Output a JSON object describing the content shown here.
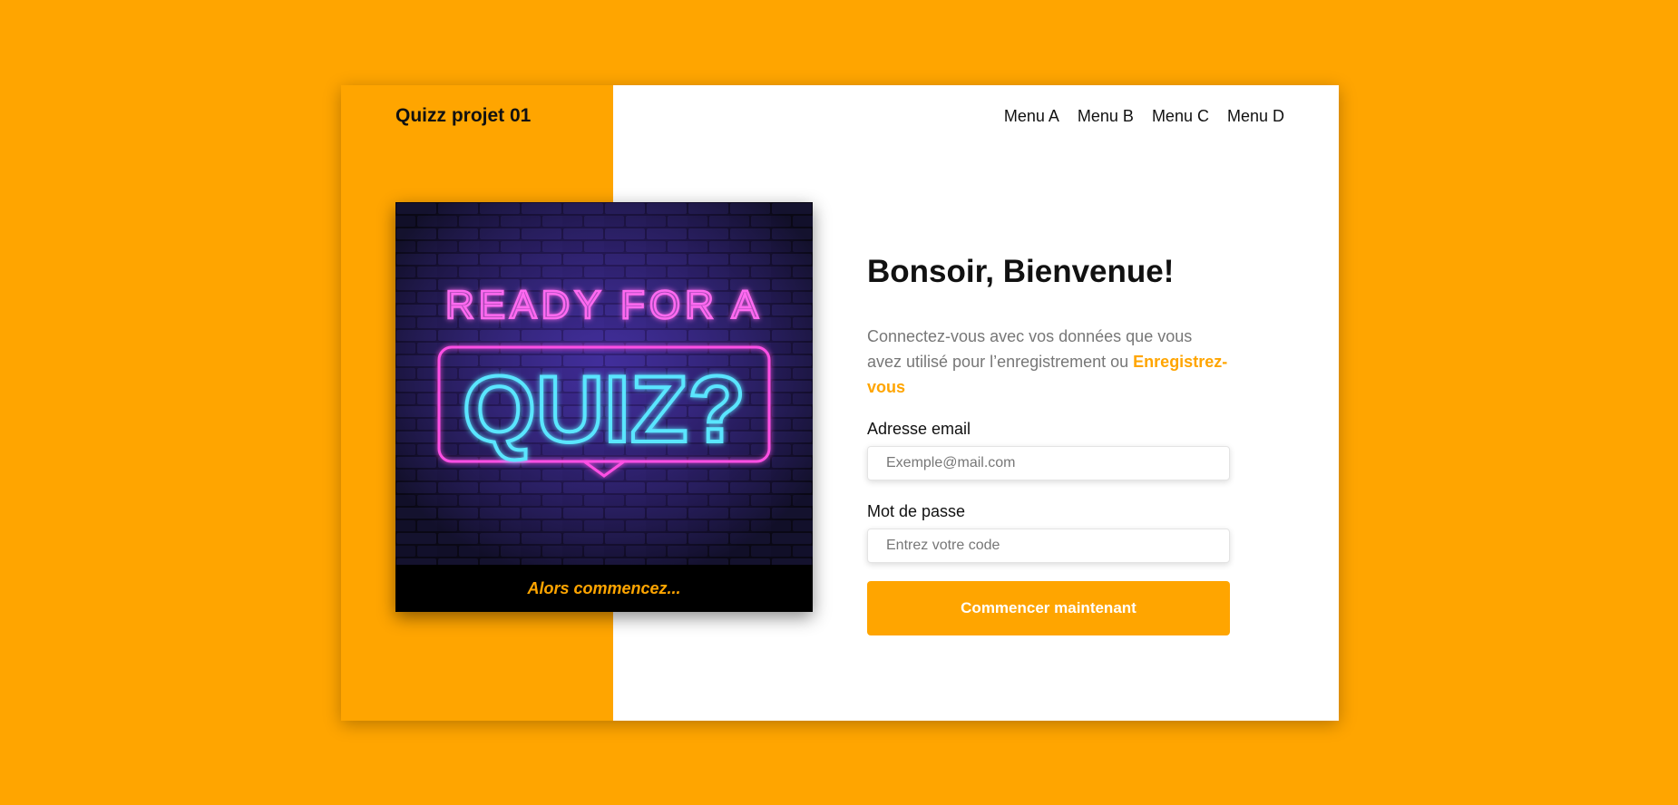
{
  "header": {
    "brand": "Quizz projet 01",
    "menu": [
      "Menu A",
      "Menu B",
      "Menu C",
      "Menu D"
    ]
  },
  "hero": {
    "line1": "READY FOR A",
    "line2": "QUIZ?",
    "caption": "Alors commencez..."
  },
  "form": {
    "title": "Bonsoir, Bienvenue!",
    "subtitle_text": "Connectez-vous avec vos données que vous avez utilisé pour l’enregistrement ou",
    "register_link": "Enregistrez-vous",
    "email_label": "Adresse email",
    "email_placeholder": "Exemple@mail.com",
    "password_label": "Mot de passe",
    "password_placeholder": "Entrez votre code",
    "submit_label": "Commencer maintenant"
  },
  "colors": {
    "accent": "#FFA500",
    "card": "#ffffff",
    "text": "#111111",
    "muted": "#777777",
    "neon_pink": "#ff4fe4",
    "neon_cyan": "#5ae6ff"
  }
}
